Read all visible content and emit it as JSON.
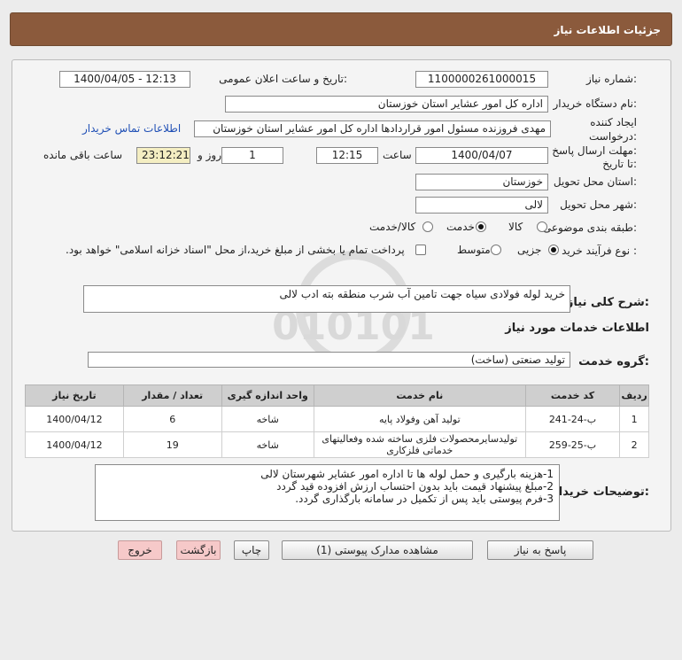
{
  "header": {
    "title": "جزئیات اطلاعات نیاز"
  },
  "form": {
    "need_number_label": "شماره نیاز:",
    "need_number": "1100000261000015",
    "announce_label": "تاریخ و ساعت اعلان عمومی:",
    "announce_value": "1400/04/05 - 12:13",
    "buyer_org_label": "نام دستگاه خریدار:",
    "buyer_org": "اداره کل امور عشایر استان خوزستان",
    "creator_label": "ایجاد کننده",
    "creator_label2": "درخواست:",
    "creator": "مهدی فروزنده مسئول امور قراردادها اداره کل امور عشایر استان خوزستان",
    "contact_link": "اطلاعات تماس خریدار",
    "deadline_label": "مهلت ارسال پاسخ:",
    "deadline_label2": "تا تاریخ:",
    "deadline_date": "1400/04/07",
    "time_label": "ساعت",
    "deadline_time": "12:15",
    "days": "1",
    "days_label": "روز و",
    "remaining": "23:12:21",
    "remaining_label": "ساعت باقی مانده",
    "province_label": "استان محل تحویل:",
    "province": "خوزستان",
    "city_label": "شهر محل تحویل:",
    "city": "لالی",
    "category_label": "طبقه بندی موضوعی:",
    "category_options": [
      "کالا",
      "خدمت",
      "کالا/خدمت"
    ],
    "category_selected": "خدمت",
    "process_label": "نوع فرآیند خرید :",
    "process_options": [
      "جزیی",
      "متوسط"
    ],
    "process_selected": "جزیی",
    "payment_text": "پرداخت تمام یا بخشی از مبلغ خرید،از محل \"اسناد خزانه اسلامی\" خواهد بود."
  },
  "summary": {
    "label": "شرح کلی نیاز:",
    "value": "خرید لوله فولادی سیاه جهت تامین آب شرب منطقه بته ادب لالی"
  },
  "services": {
    "section_title": "اطلاعات خدمات مورد نیاز",
    "group_label": "گروه خدمت:",
    "group_value": "تولید صنعتی (ساخت)",
    "columns": [
      "ردیف",
      "کد خدمت",
      "نام خدمت",
      "واحد اندازه گیری",
      "تعداد / مقدار",
      "تاریخ نیاز"
    ],
    "rows": [
      {
        "idx": "1",
        "code": "ب-24-241",
        "name": "تولید آهن وفولاد پایه",
        "unit": "شاخه",
        "qty": "6",
        "date": "1400/04/12"
      },
      {
        "idx": "2",
        "code": "ب-25-259",
        "name": "تولیدسایرمحصولات فلزی ساخته شده وفعالیتهای خدماتی فلزکاری",
        "unit": "شاخه",
        "qty": "19",
        "date": "1400/04/12"
      }
    ]
  },
  "notes": {
    "label": "توضیحات خریدار:",
    "text": "1-هزینه بارگیری و حمل لوله ها تا اداره امور عشایر شهرستان لالی\n2-مبلغ پیشنهاد قیمت باید بدون احتساب ارزش افزوده قید گردد\n3-فرم پیوستی باید پس از تکمیل در سامانه بارگذاری گردد."
  },
  "buttons": {
    "reply": "پاسخ به نیاز",
    "attachments": "مشاهده مدارک پیوستی (1)",
    "print": "چاپ",
    "back": "بازگشت",
    "exit": "خروج"
  },
  "watermark": {
    "text": "ParsNamadData"
  }
}
